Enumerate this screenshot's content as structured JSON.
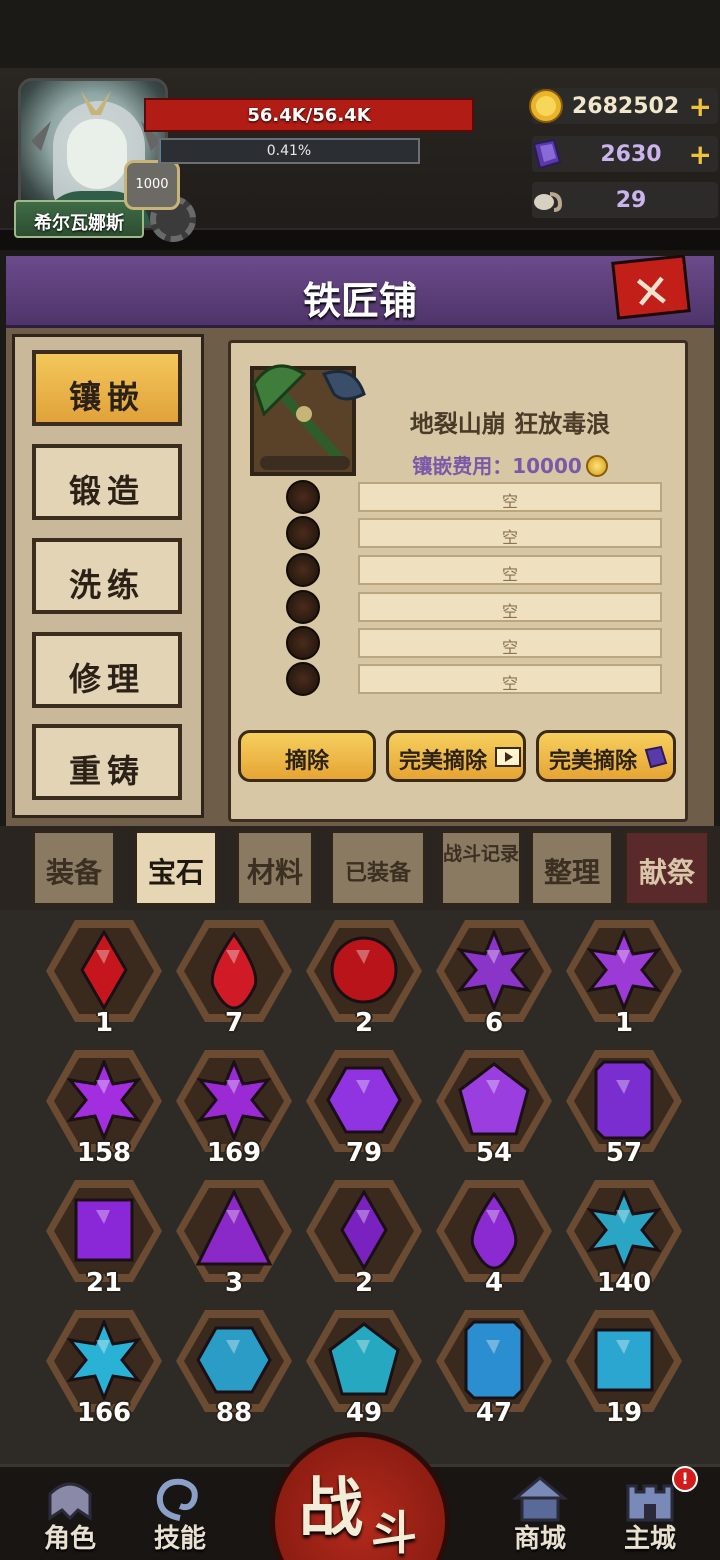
{
  "player": {
    "name": "希尔瓦娜斯",
    "level": "1000",
    "hp_text": "56.4K/56.4K",
    "xp_text": "0.41%",
    "xp_progress": 0.41
  },
  "resources": {
    "gold": "2682502",
    "crystal": "2630",
    "horn": "29",
    "plus_icon": "plus-icon"
  },
  "window": {
    "title": "铁匠铺",
    "close_label": "✕"
  },
  "menu": [
    {
      "label": "镶嵌",
      "active": true
    },
    {
      "label": "锻造",
      "active": false
    },
    {
      "label": "洗练",
      "active": false
    },
    {
      "label": "修理",
      "active": false
    },
    {
      "label": "重铸",
      "active": false
    }
  ],
  "equipment": {
    "name": "地裂山崩 狂放毒浪",
    "cost_text": "镶嵌费用：10000",
    "slots": [
      "空",
      "空",
      "空",
      "空",
      "空",
      "空"
    ]
  },
  "actions": {
    "remove": "摘除",
    "perfect_remove_ad": "完美摘除",
    "perfect_remove_crystal": "完美摘除"
  },
  "tabs": [
    {
      "label": "装备"
    },
    {
      "label": "宝石",
      "active": true
    },
    {
      "label": "材料"
    },
    {
      "label": "已装备"
    },
    {
      "label": "战斗记录"
    },
    {
      "label": "整理"
    },
    {
      "label": "献祭"
    }
  ],
  "gems": [
    {
      "count": "1",
      "color": "#c4161c",
      "shape": "marquise"
    },
    {
      "count": "7",
      "color": "#d01b26",
      "shape": "drop"
    },
    {
      "count": "2",
      "color": "#b8141a",
      "shape": "round"
    },
    {
      "count": "6",
      "color": "#8a34c8",
      "shape": "star"
    },
    {
      "count": "1",
      "color": "#9c3ad6",
      "shape": "star"
    },
    {
      "count": "158",
      "color": "#a22ee0",
      "shape": "star"
    },
    {
      "count": "169",
      "color": "#9a2ad4",
      "shape": "star"
    },
    {
      "count": "79",
      "color": "#8f34e0",
      "shape": "hexagon"
    },
    {
      "count": "54",
      "color": "#9a3ee0",
      "shape": "pentagon"
    },
    {
      "count": "57",
      "color": "#7a2ed0",
      "shape": "emerald"
    },
    {
      "count": "21",
      "color": "#8a28d8",
      "shape": "square"
    },
    {
      "count": "3",
      "color": "#8a28c8",
      "shape": "trillion"
    },
    {
      "count": "2",
      "color": "#7a22c0",
      "shape": "marquise"
    },
    {
      "count": "4",
      "color": "#8a2ad0",
      "shape": "drop"
    },
    {
      "count": "140",
      "color": "#2aa6c4",
      "shape": "star"
    },
    {
      "count": "166",
      "color": "#2ab2d6",
      "shape": "star"
    },
    {
      "count": "88",
      "color": "#2a9cc6",
      "shape": "hexagon"
    },
    {
      "count": "49",
      "color": "#26a8c0",
      "shape": "pentagon"
    },
    {
      "count": "47",
      "color": "#2a8ed0",
      "shape": "emerald"
    },
    {
      "count": "19",
      "color": "#2aa6d0",
      "shape": "square"
    }
  ],
  "nav": {
    "role": "角色",
    "skill": "技能",
    "battle_1": "战",
    "battle_2": "斗",
    "shop": "商城",
    "city": "主城",
    "city_alert": "!"
  }
}
